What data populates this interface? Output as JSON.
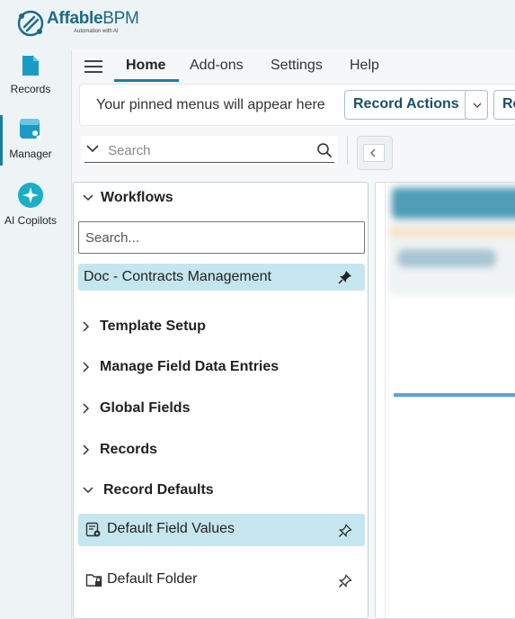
{
  "brand": {
    "name_bold": "Affable",
    "name_rest": "BPM",
    "tagline": "Automation with AI"
  },
  "rail": {
    "items": [
      {
        "label": "Records"
      },
      {
        "label": "Manager"
      },
      {
        "label": "AI Copilots"
      }
    ]
  },
  "menu": {
    "tabs": [
      {
        "label": "Home"
      },
      {
        "label": "Add-ons"
      },
      {
        "label": "Settings"
      },
      {
        "label": "Help"
      }
    ]
  },
  "pinned": {
    "message": "Your pinned menus will appear here",
    "record_actions_label": "Record Actions",
    "next_button_label": "Re"
  },
  "search": {
    "placeholder": "Search"
  },
  "tree": {
    "header": "Workflows",
    "search_placeholder": "Search...",
    "selected_workflow": "Doc - Contracts Management",
    "sections": [
      {
        "label": "Template Setup"
      },
      {
        "label": "Manage Field Data Entries"
      },
      {
        "label": "Global Fields"
      },
      {
        "label": "Records"
      },
      {
        "label": "Record Defaults"
      }
    ],
    "leaves": [
      {
        "label": "Default Field Values"
      },
      {
        "label": "Default Folder"
      }
    ]
  },
  "colors": {
    "accent": "#1b7fa0",
    "selected_bg": "#c5e6ee",
    "button_border": "#9fc3d0"
  }
}
